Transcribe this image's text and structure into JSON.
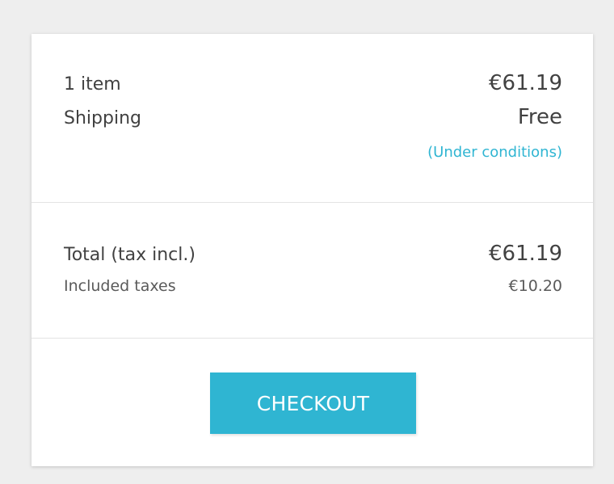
{
  "cart_summary": {
    "items_label": "1 item",
    "items_value": "€61.19",
    "shipping_label": "Shipping",
    "shipping_value": "Free",
    "shipping_note": "(Under conditions)",
    "total_label": "Total (tax incl.)",
    "total_value": "€61.19",
    "taxes_label": "Included taxes",
    "taxes_value": "€10.20",
    "checkout_label": "CHECKOUT"
  },
  "colors": {
    "accent": "#2fb5d2",
    "text": "#414141",
    "background": "#eeeeee",
    "card": "#ffffff"
  }
}
